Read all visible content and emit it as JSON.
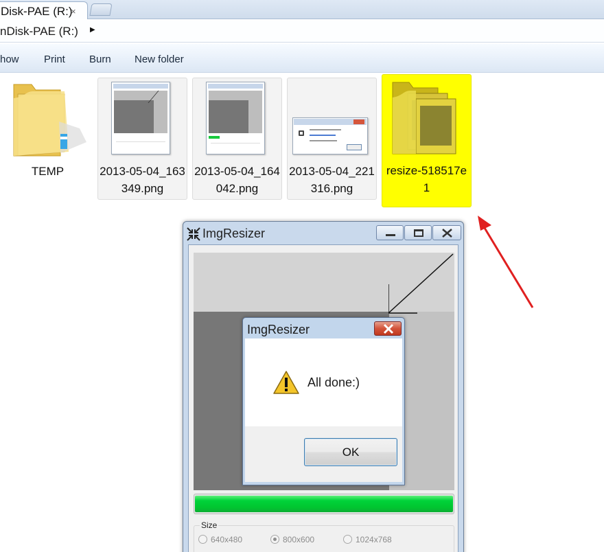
{
  "window": {
    "tab_title": "Disk-PAE (R:)",
    "tab_close": "×"
  },
  "address": {
    "path": "nDisk-PAE (R:)"
  },
  "toolbar": {
    "items": [
      "how",
      "Print",
      "Burn",
      "New folder"
    ]
  },
  "files": [
    {
      "name": "TEMP",
      "kind": "folder"
    },
    {
      "name": "2013-05-04_163349.png",
      "kind": "png"
    },
    {
      "name": "2013-05-04_164042.png",
      "kind": "png"
    },
    {
      "name": "2013-05-04_221316.png",
      "kind": "png"
    },
    {
      "name": "resize-518517e1",
      "kind": "folder",
      "selected": true
    }
  ],
  "app": {
    "title": "ImgResizer",
    "progress_fraction": 1.0,
    "size_group_label": "Size",
    "size_options": [
      {
        "label": "640x480",
        "checked": false
      },
      {
        "label": "800x600",
        "checked": true
      },
      {
        "label": "1024x768",
        "checked": false
      }
    ]
  },
  "dialog": {
    "title": "ImgResizer",
    "message": "All done:)",
    "ok_label": "OK"
  },
  "annotation": {
    "arrow_color": "#e02020",
    "highlight_color": "#ffff00"
  }
}
